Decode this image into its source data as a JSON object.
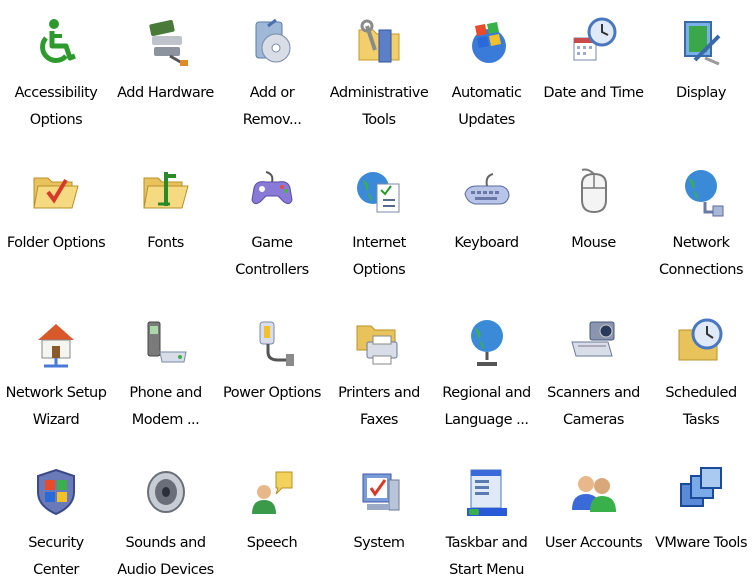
{
  "items": [
    {
      "line1": "Accessibility",
      "line2": "Options",
      "icon": "accessibility-icon"
    },
    {
      "line1": "Add Hardware",
      "line2": "",
      "icon": "add-hardware-icon"
    },
    {
      "line1": "Add or",
      "line2": "Remov...",
      "icon": "add-remove-programs-icon"
    },
    {
      "line1": "Administrative",
      "line2": "Tools",
      "icon": "administrative-tools-icon"
    },
    {
      "line1": "Automatic",
      "line2": "Updates",
      "icon": "automatic-updates-icon"
    },
    {
      "line1": "Date and Time",
      "line2": "",
      "icon": "date-time-icon"
    },
    {
      "line1": "Display",
      "line2": "",
      "icon": "display-icon"
    },
    {
      "line1": "Folder Options",
      "line2": "",
      "icon": "folder-options-icon"
    },
    {
      "line1": "Fonts",
      "line2": "",
      "icon": "fonts-icon"
    },
    {
      "line1": "Game",
      "line2": "Controllers",
      "icon": "game-controllers-icon"
    },
    {
      "line1": "Internet",
      "line2": "Options",
      "icon": "internet-options-icon"
    },
    {
      "line1": "Keyboard",
      "line2": "",
      "icon": "keyboard-icon"
    },
    {
      "line1": "Mouse",
      "line2": "",
      "icon": "mouse-icon"
    },
    {
      "line1": "Network",
      "line2": "Connections",
      "icon": "network-connections-icon"
    },
    {
      "line1": "Network Setup",
      "line2": "Wizard",
      "icon": "network-setup-wizard-icon"
    },
    {
      "line1": "Phone and",
      "line2": "Modem ...",
      "icon": "phone-modem-icon"
    },
    {
      "line1": "Power Options",
      "line2": "",
      "icon": "power-options-icon"
    },
    {
      "line1": "Printers and",
      "line2": "Faxes",
      "icon": "printers-faxes-icon"
    },
    {
      "line1": "Regional and",
      "line2": "Language ...",
      "icon": "regional-language-icon"
    },
    {
      "line1": "Scanners and",
      "line2": "Cameras",
      "icon": "scanners-cameras-icon"
    },
    {
      "line1": "Scheduled",
      "line2": "Tasks",
      "icon": "scheduled-tasks-icon"
    },
    {
      "line1": "Security",
      "line2": "Center",
      "icon": "security-center-icon"
    },
    {
      "line1": "Sounds and",
      "line2": "Audio Devices",
      "icon": "sounds-audio-icon"
    },
    {
      "line1": "Speech",
      "line2": "",
      "icon": "speech-icon"
    },
    {
      "line1": "System",
      "line2": "",
      "icon": "system-icon"
    },
    {
      "line1": "Taskbar and",
      "line2": "Start Menu",
      "icon": "taskbar-start-menu-icon"
    },
    {
      "line1": "User Accounts",
      "line2": "",
      "icon": "user-accounts-icon"
    },
    {
      "line1": "VMware Tools",
      "line2": "",
      "icon": "vmware-tools-icon"
    }
  ]
}
